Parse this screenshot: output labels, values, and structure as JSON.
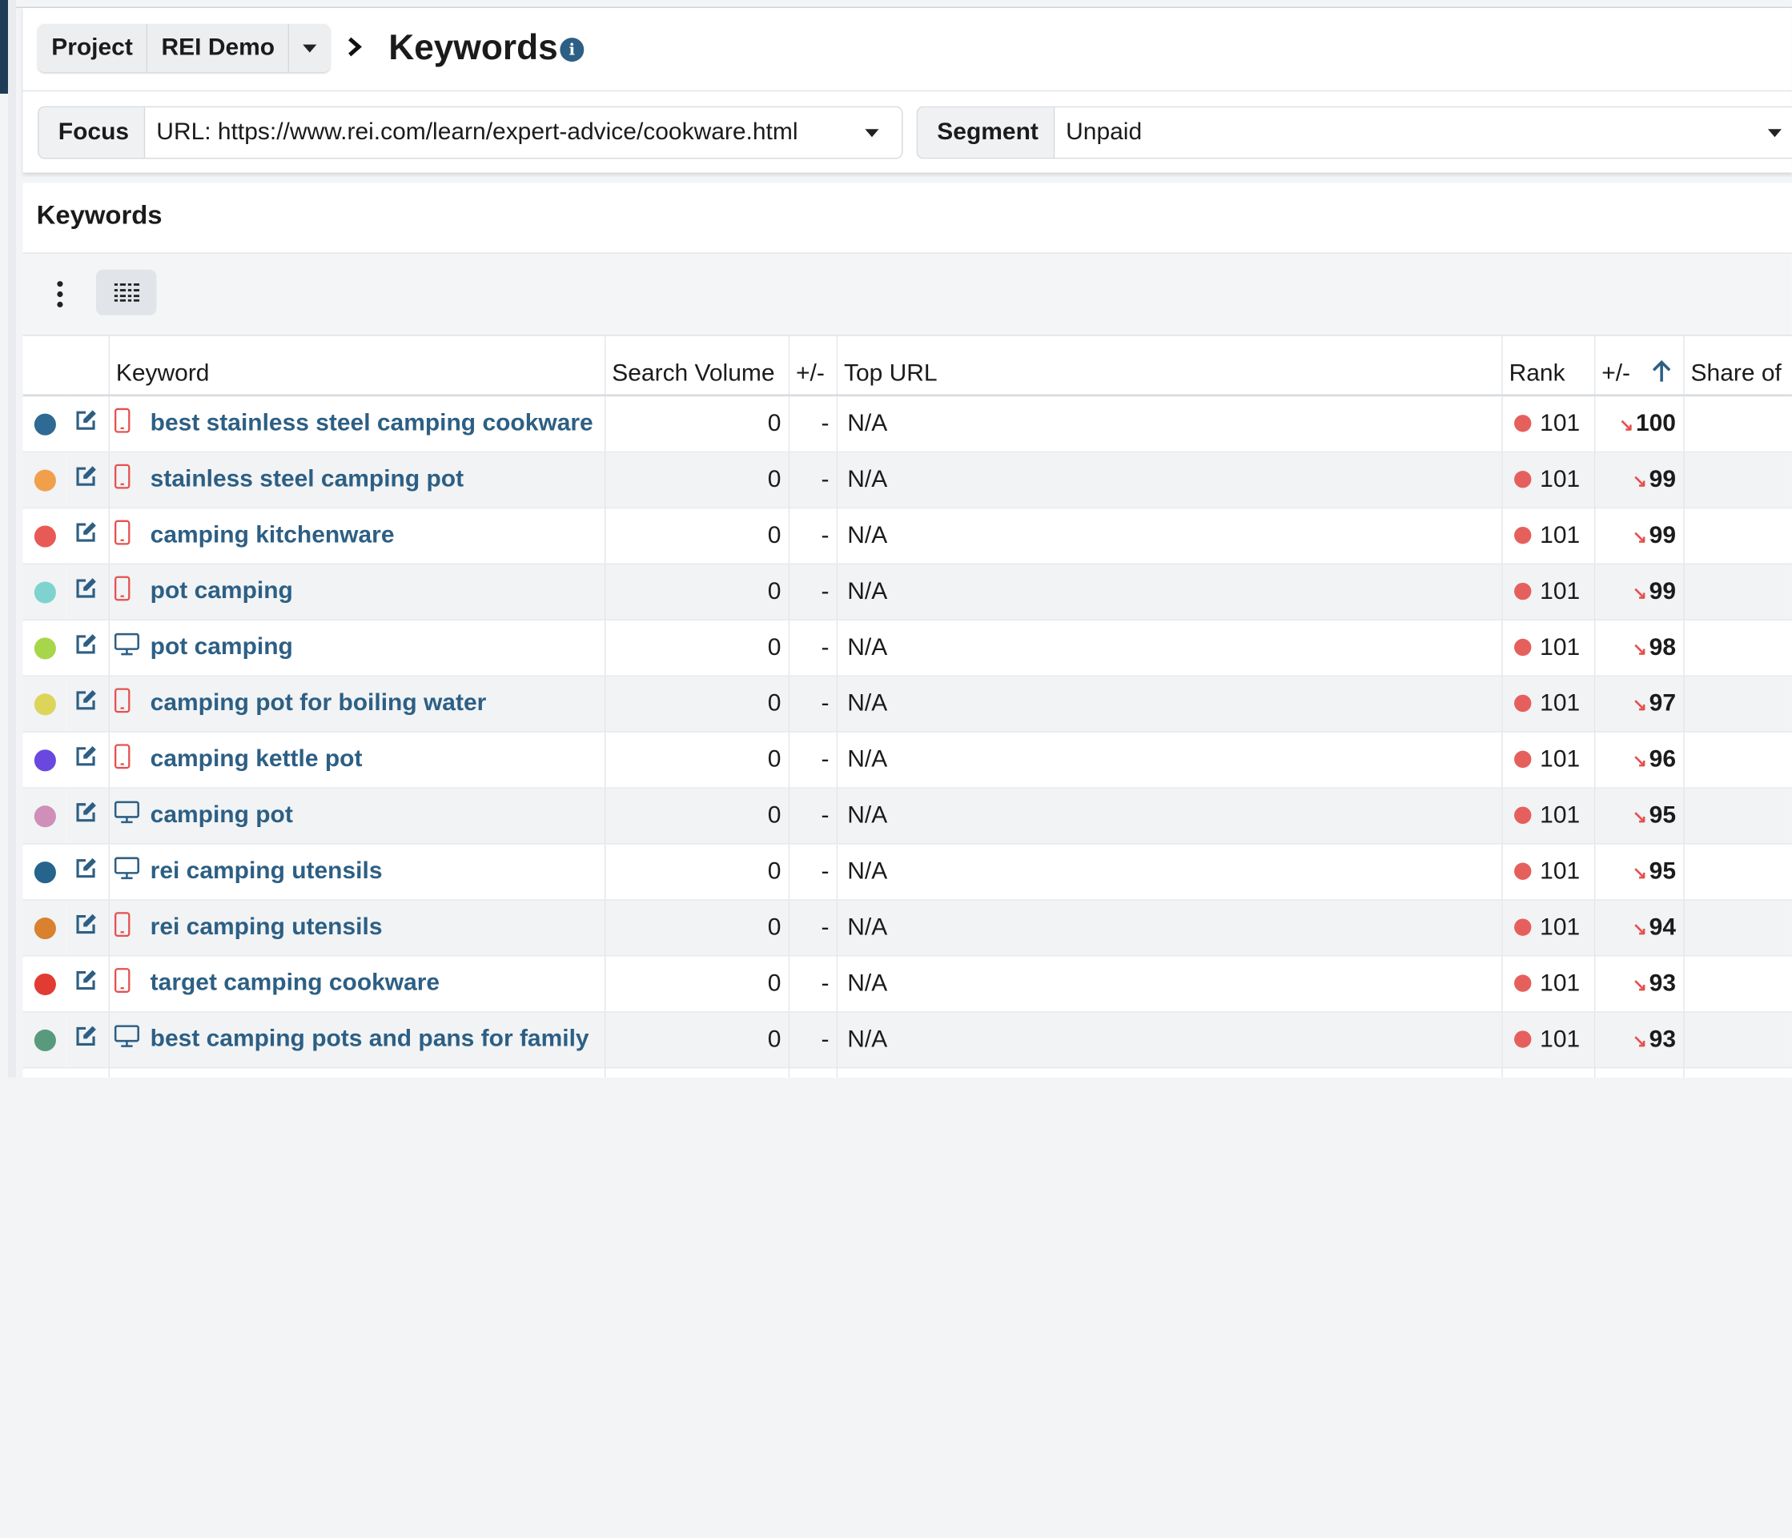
{
  "header": {
    "project_label": "Project",
    "project_name": "REI Demo",
    "page_title": "Keywords",
    "focus_label": "Focus",
    "focus_value": "URL: https://www.rei.com/learn/expert-advice/cookware.html",
    "segment_label": "Segment",
    "segment_value": "Unpaid"
  },
  "panel": {
    "title": "Keywords"
  },
  "table": {
    "columns": {
      "keyword": "Keyword",
      "search_volume": "Search Volume",
      "sv_change": "+/-",
      "top_url": "Top URL",
      "rank": "Rank",
      "rank_change": "+/-",
      "share_of": "Share of"
    },
    "rows": [
      {
        "color": "#2e6a93",
        "device": "mobile",
        "keyword": "best stainless steel camping cookware",
        "volume": "0",
        "vol_change": "-",
        "top_url": "N/A",
        "rank": "101",
        "change": "100"
      },
      {
        "color": "#f0a04b",
        "device": "mobile",
        "keyword": "stainless steel camping pot",
        "volume": "0",
        "vol_change": "-",
        "top_url": "N/A",
        "rank": "101",
        "change": "99"
      },
      {
        "color": "#e85a55",
        "device": "mobile",
        "keyword": "camping kitchenware",
        "volume": "0",
        "vol_change": "-",
        "top_url": "N/A",
        "rank": "101",
        "change": "99"
      },
      {
        "color": "#7fd3cf",
        "device": "mobile",
        "keyword": "pot camping",
        "volume": "0",
        "vol_change": "-",
        "top_url": "N/A",
        "rank": "101",
        "change": "99"
      },
      {
        "color": "#a8d64a",
        "device": "desktop",
        "keyword": "pot camping",
        "volume": "0",
        "vol_change": "-",
        "top_url": "N/A",
        "rank": "101",
        "change": "98"
      },
      {
        "color": "#dcd55a",
        "device": "mobile",
        "keyword": "camping pot for boiling water",
        "volume": "0",
        "vol_change": "-",
        "top_url": "N/A",
        "rank": "101",
        "change": "97"
      },
      {
        "color": "#6a48e0",
        "device": "mobile",
        "keyword": "camping kettle pot",
        "volume": "0",
        "vol_change": "-",
        "top_url": "N/A",
        "rank": "101",
        "change": "96"
      },
      {
        "color": "#cf8fb8",
        "device": "desktop",
        "keyword": "camping pot",
        "volume": "0",
        "vol_change": "-",
        "top_url": "N/A",
        "rank": "101",
        "change": "95"
      },
      {
        "color": "#26648e",
        "device": "desktop",
        "keyword": "rei camping utensils",
        "volume": "0",
        "vol_change": "-",
        "top_url": "N/A",
        "rank": "101",
        "change": "95"
      },
      {
        "color": "#d9812f",
        "device": "mobile",
        "keyword": "rei camping utensils",
        "volume": "0",
        "vol_change": "-",
        "top_url": "N/A",
        "rank": "101",
        "change": "94"
      },
      {
        "color": "#e03c33",
        "device": "mobile",
        "keyword": "target camping cookware",
        "volume": "0",
        "vol_change": "-",
        "top_url": "N/A",
        "rank": "101",
        "change": "93"
      },
      {
        "color": "#5a9a7c",
        "device": "desktop",
        "keyword": "best camping pots and pans for family",
        "volume": "0",
        "vol_change": "-",
        "top_url": "N/A",
        "rank": "101",
        "change": "93"
      }
    ]
  },
  "colors": {
    "link": "#2d5f84",
    "rank_dot": "#e5605d",
    "trend_down": "#e5504f",
    "partial_row_dot": "#8fd14f"
  }
}
